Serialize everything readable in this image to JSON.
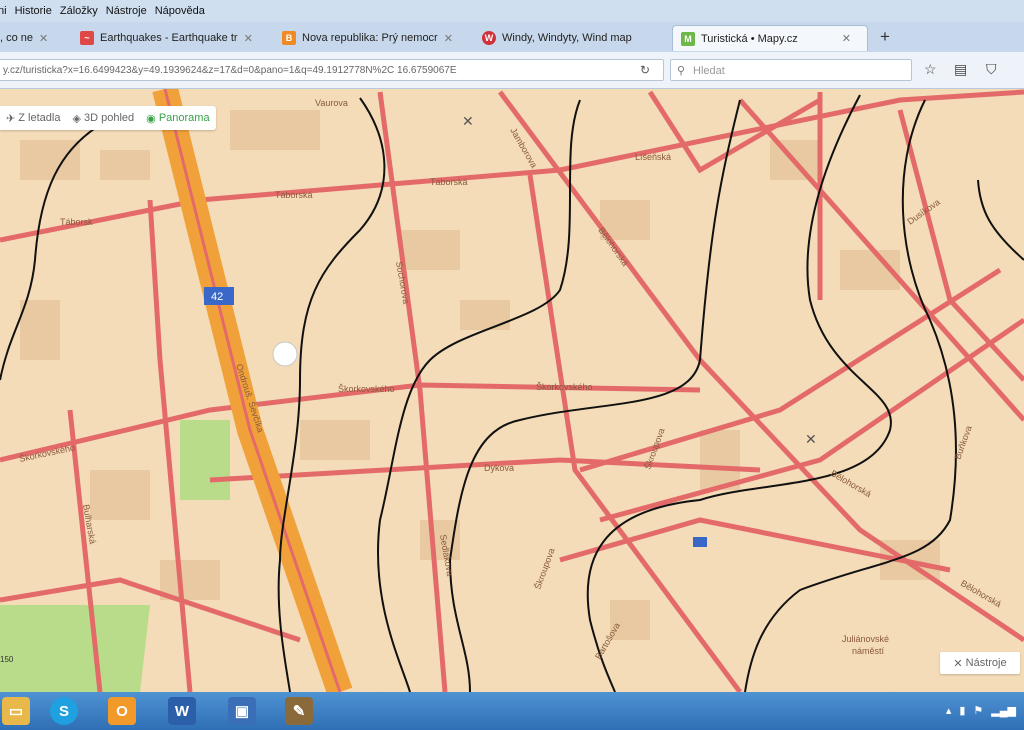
{
  "menu": [
    "ni",
    "Historie",
    "Záložky",
    "Nástroje",
    "Nápověda"
  ],
  "tabs": [
    {
      "label": ", co ne",
      "fav_color": "#ffffff"
    },
    {
      "label": "Earthquakes - Earthquake tr",
      "fav_color": "#e04848"
    },
    {
      "label": "Nova republika: Prý nemocr",
      "fav_color": "#f08a24"
    },
    {
      "label": "Windy, Windyty, Wind map",
      "fav_color": "#d0303a"
    },
    {
      "label": "Turistická • Mapy.cz",
      "fav_color": "#6cb84a"
    }
  ],
  "url": "y.cz/turisticka?x=16.6499423&y=49.1939624&z=17&d=0&pano=1&q=49.1912778N%2C 16.6759067E",
  "search_placeholder": "Hledat",
  "map_buttons": {
    "z_letadla": "Z letadla",
    "pohled_3d": "3D pohled",
    "panorama": "Panorama"
  },
  "tools_label": "Nástroje",
  "streets": {
    "taborska1": "Táborská",
    "taborska2": "Táborská",
    "taborska3": "Táborsk",
    "lisenska": "Líšeňská",
    "jamborova": "Jamborova",
    "belohorska1": "Bělohorská",
    "belohorska2": "Bělohorská",
    "belohorska3": "Bělohorská",
    "skorkovskeho1": "Škorkovského",
    "skorkovskeho2": "Škorkovského",
    "skorkovskeho3": "Škorkovského",
    "dykova": "Dykova",
    "skroupova1": "Škroupova",
    "skroupova2": "Škroupova",
    "ondrej": "Ondrouš. Ševčíka",
    "bulharska": "Bulharská",
    "juliano1": "Juliánovské",
    "juliano2": "náměstí",
    "sochor": "Sochorova",
    "bunka": "Buňkova",
    "dusikova": "Dusíkova",
    "vaurova": "Vaurova",
    "sedlakova": "Sedlákova",
    "bartos": "Bartošova"
  },
  "scale_label": "150",
  "taskbar_icons": [
    "explorer-icon",
    "skype-icon",
    "outlook-icon",
    "word-icon",
    "save-icon",
    "paint-icon"
  ],
  "colors": {
    "map_bg": "#f3dcb7",
    "street": "#e46a6a",
    "street_fill": "#f6b0a6",
    "highway": "#f0a13a",
    "park": "#b9dc8a",
    "drawn_line": "#111111"
  }
}
